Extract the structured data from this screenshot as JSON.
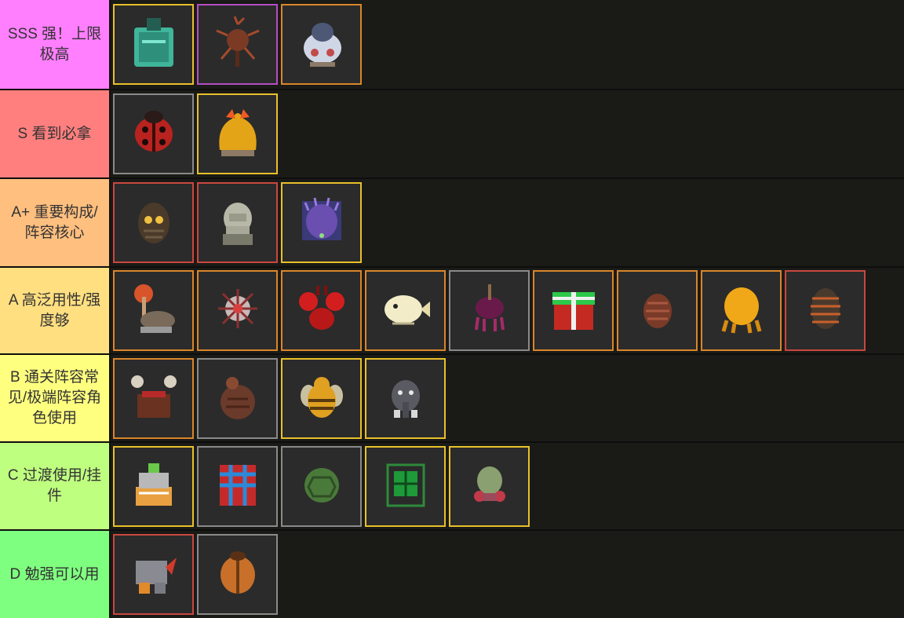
{
  "colors": {
    "tier_bg": {
      "sss": "#ff7fff",
      "s": "#ff7f7f",
      "a_plus": "#ffbf7f",
      "a": "#ffdf80",
      "b": "#ffff7f",
      "c": "#bfff7f",
      "d": "#7fff7f"
    },
    "rarity_border": {
      "gold": "#e8c02a",
      "orange": "#d9862a",
      "gray": "#8a8a8a",
      "red": "#c9473f",
      "purple": "#b44ec4"
    }
  },
  "tiers": [
    {
      "id": "sss",
      "label": "SSS 强！上限极高",
      "items": [
        {
          "icon": "green-crystal-beast-icon",
          "rarity": "gold"
        },
        {
          "icon": "red-dandelion-beast-icon",
          "rarity": "purple"
        },
        {
          "icon": "white-penguin-icon",
          "rarity": "orange"
        }
      ]
    },
    {
      "id": "s",
      "label": "S 看到必拿",
      "items": [
        {
          "icon": "ladybug-icon",
          "rarity": "gray"
        },
        {
          "icon": "golden-phoenix-icon",
          "rarity": "gold"
        }
      ]
    },
    {
      "id": "a_plus",
      "label": "A+ 重要构成/阵容核心",
      "items": [
        {
          "icon": "owl-egg-icon",
          "rarity": "red"
        },
        {
          "icon": "stone-lion-statue-icon",
          "rarity": "red"
        },
        {
          "icon": "purple-hedgehog-icon",
          "rarity": "gold"
        }
      ]
    },
    {
      "id": "a",
      "label": "A 高泛用性/强度够",
      "items": [
        {
          "icon": "mushroom-ostrich-icon",
          "rarity": "orange"
        },
        {
          "icon": "sea-urchin-icon",
          "rarity": "orange"
        },
        {
          "icon": "red-crab-icon",
          "rarity": "orange"
        },
        {
          "icon": "puffer-fish-icon",
          "rarity": "orange"
        },
        {
          "icon": "purple-squid-icon",
          "rarity": "gray"
        },
        {
          "icon": "gift-box-icon",
          "rarity": "orange"
        },
        {
          "icon": "brown-pinecone-icon",
          "rarity": "orange"
        },
        {
          "icon": "yellow-octopus-icon",
          "rarity": "orange"
        },
        {
          "icon": "pill-bug-icon",
          "rarity": "red"
        }
      ]
    },
    {
      "id": "b",
      "label": "B 通关阵容常见/极端阵容角色使用",
      "items": [
        {
          "icon": "crab-cauldron-icon",
          "rarity": "orange"
        },
        {
          "icon": "brown-chicken-icon",
          "rarity": "gray"
        },
        {
          "icon": "bee-icon",
          "rarity": "gold"
        },
        {
          "icon": "elephant-robot-icon",
          "rarity": "gold"
        }
      ]
    },
    {
      "id": "c",
      "label": "C 过渡使用/挂件",
      "items": [
        {
          "icon": "robot-crab-icon",
          "rarity": "gold"
        },
        {
          "icon": "blue-cage-icon",
          "rarity": "gray"
        },
        {
          "icon": "turtle-shell-icon",
          "rarity": "gray"
        },
        {
          "icon": "green-circuit-box-icon",
          "rarity": "gold"
        },
        {
          "icon": "mossy-rock-crab-icon",
          "rarity": "gold"
        }
      ]
    },
    {
      "id": "d",
      "label": "D 勉强可以用",
      "items": [
        {
          "icon": "armored-rhino-icon",
          "rarity": "red"
        },
        {
          "icon": "brown-beetle-icon",
          "rarity": "gray"
        }
      ]
    }
  ]
}
